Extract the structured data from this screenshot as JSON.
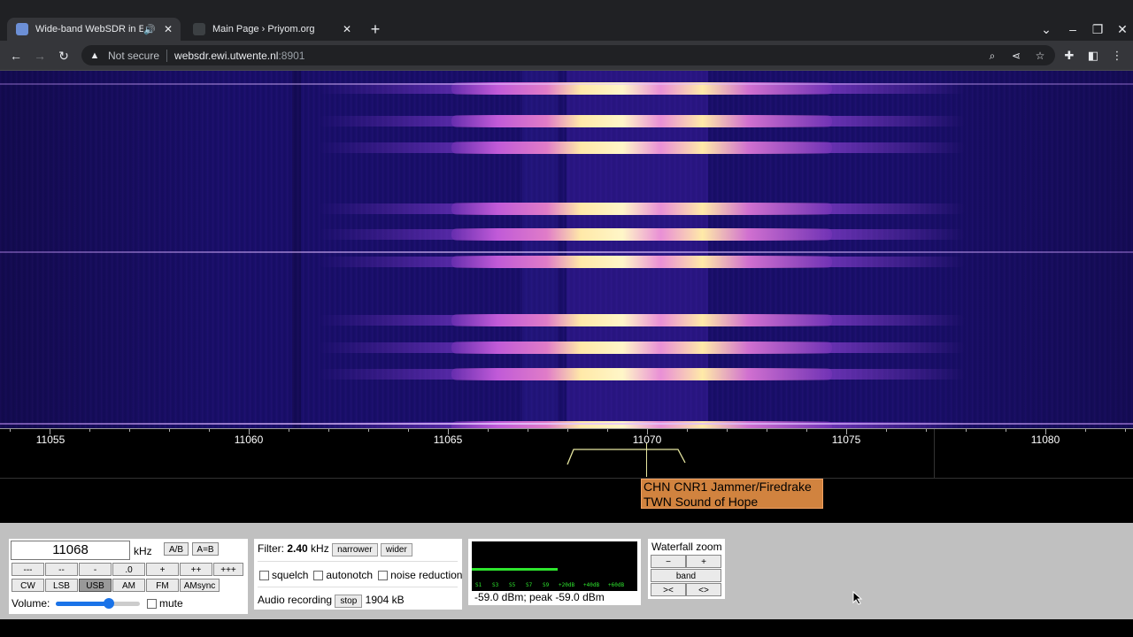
{
  "browser": {
    "tabs": [
      {
        "title": "Wide-band WebSDR in Ensch",
        "active": true
      },
      {
        "title": "Main Page › Priyom.org",
        "active": false
      }
    ],
    "security_label": "Not secure",
    "url_host": "websdr.ewi.utwente.nl",
    "url_port": ":8901"
  },
  "scale": {
    "ticks": [
      "11055",
      "11060",
      "11065",
      "11070",
      "11075",
      "11080"
    ]
  },
  "station_labels": [
    "CHN CNR1 Jammer/Firedrake",
    "TWN Sound of Hope"
  ],
  "controls": {
    "frequency": "11068",
    "unit": "kHz",
    "ab_label": "A/B",
    "aeqb_label": "A=B",
    "step_buttons": [
      "---",
      "--",
      "-",
      ".0",
      "+",
      "++",
      "+++"
    ],
    "modes": [
      "CW",
      "LSB",
      "USB",
      "AM",
      "FM",
      "AMsync"
    ],
    "active_mode": "USB",
    "volume_label": "Volume:",
    "volume_level": 0.63,
    "mute_label": "mute"
  },
  "filter": {
    "label": "Filter:",
    "value": "2.40",
    "unit": "kHz",
    "narrower": "narrower",
    "wider": "wider",
    "squelch": "squelch",
    "autonotch": "autonotch",
    "noise_reduction": "noise reduction",
    "recording_label": "Audio recording",
    "stop": "stop",
    "size": "1904 kB"
  },
  "smeter": {
    "scale": [
      "S1",
      "S3",
      "S5",
      "S7",
      "S9",
      "+20dB",
      "+40dB",
      "+60dB"
    ],
    "reading": "-59.0 dBm; peak  -59.0 dBm",
    "level": 0.52
  },
  "zoom": {
    "title": "Waterfall zoom",
    "minus": "−",
    "plus": "+",
    "band": "band",
    "shrink": "><",
    "expand": "<>"
  },
  "colors": {
    "accent": "#1a73e8",
    "station_label": "#d1833f",
    "waterfall_bg": "#1a0f6e",
    "smeter_bar": "#2ee62e"
  }
}
